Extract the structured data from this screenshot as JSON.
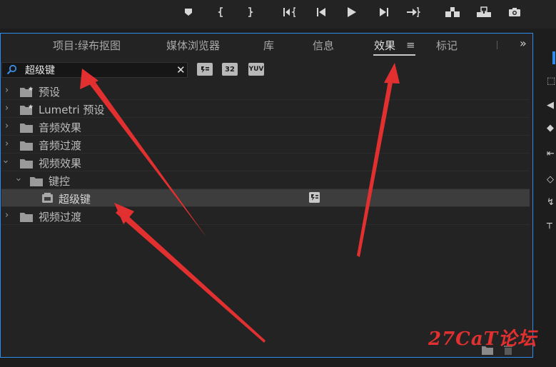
{
  "transport": {
    "buttons": [
      "marker-icon",
      "mark-in-icon",
      "mark-out-icon",
      "go-to-in-icon",
      "step-back-icon",
      "play-icon",
      "step-forward-icon",
      "go-to-out-icon",
      "insert-icon",
      "overwrite-icon",
      "export-frame-icon"
    ]
  },
  "panel": {
    "tabs": [
      {
        "label": "项目:绿布抠图",
        "active": false
      },
      {
        "label": "媒体浏览器",
        "active": false
      },
      {
        "label": "库",
        "active": false
      },
      {
        "label": "信息",
        "active": false
      },
      {
        "label": "效果",
        "active": true
      },
      {
        "label": "标记",
        "active": false
      }
    ],
    "menu_glyph": "≡",
    "overflow_glyph": "»"
  },
  "search": {
    "value": "超级键",
    "clear_glyph": "✕"
  },
  "filters": [
    {
      "label": "",
      "icon": "accelerated-effects-icon"
    },
    {
      "label": "32",
      "icon": "32bit-color-icon"
    },
    {
      "label": "YUV",
      "icon": "yuv-effects-icon"
    }
  ],
  "tree": [
    {
      "label": "预设",
      "level": 0,
      "expanded": false,
      "icon": "preset-folder-icon"
    },
    {
      "label": "Lumetri 预设",
      "level": 0,
      "expanded": false,
      "icon": "preset-folder-icon"
    },
    {
      "label": "音频效果",
      "level": 0,
      "expanded": false,
      "icon": "folder-icon"
    },
    {
      "label": "音频过渡",
      "level": 0,
      "expanded": false,
      "icon": "folder-icon"
    },
    {
      "label": "视频效果",
      "level": 0,
      "expanded": true,
      "icon": "folder-icon"
    },
    {
      "label": "键控",
      "level": 1,
      "expanded": true,
      "icon": "folder-icon"
    },
    {
      "label": "超级键",
      "level": 2,
      "selected": true,
      "icon": "effect-icon"
    },
    {
      "label": "视频过渡",
      "level": 0,
      "expanded": false,
      "icon": "folder-icon"
    }
  ],
  "watermark": "27CaT论坛",
  "colors": {
    "focus_border": "#2d8ceb",
    "annotation_arrow": "#e23030",
    "selected_row": "#3d3d3d"
  }
}
